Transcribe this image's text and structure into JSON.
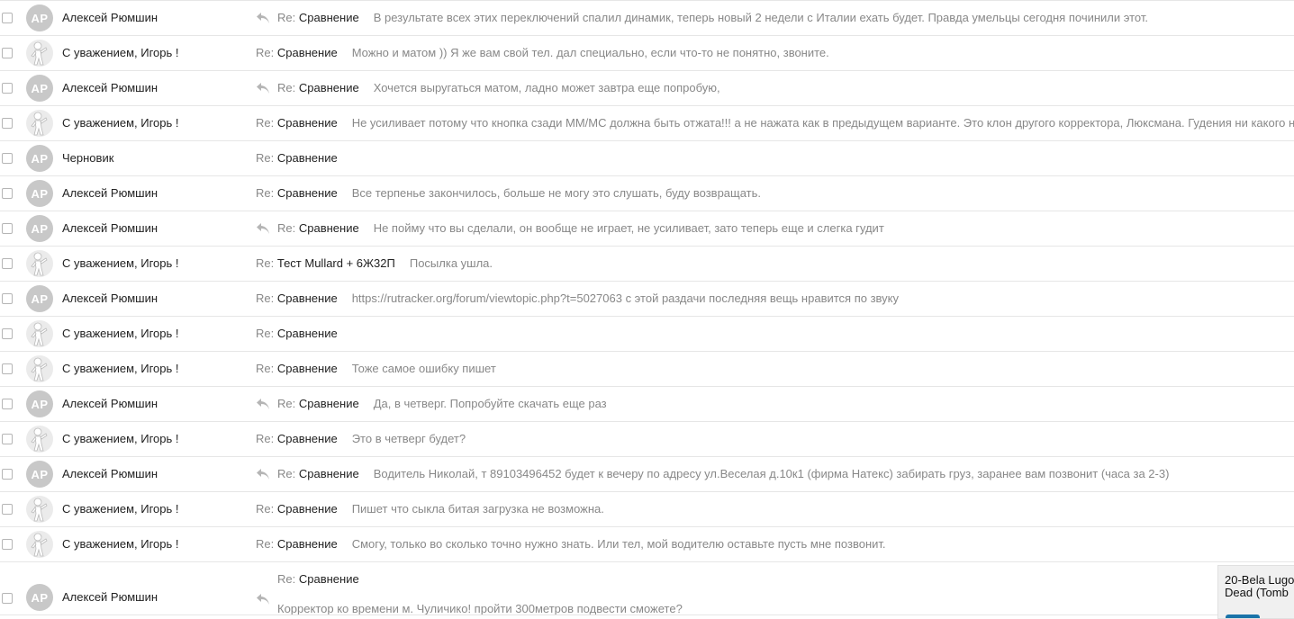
{
  "messages": [
    {
      "sender": "Алексей Рюмшин",
      "avatar": "AP",
      "avatar_type": "initials",
      "replied": true,
      "re": "Re:",
      "subject": "Сравнение",
      "snippet": "В результате всех этих переключений спалил динамик, теперь новый 2 недели с Италии ехать будет. Правда умельцы сегодня починили этот."
    },
    {
      "sender": "С уважением, Игорь !",
      "avatar": "",
      "avatar_type": "figure",
      "replied": false,
      "re": "Re:",
      "subject": "Сравнение",
      "snippet": "Можно и матом )) Я же вам свой тел. дал специально, если что-то не понятно, звоните."
    },
    {
      "sender": "Алексей Рюмшин",
      "avatar": "AP",
      "avatar_type": "initials",
      "replied": true,
      "re": "Re:",
      "subject": "Сравнение",
      "snippet": "Хочется выругаться матом, ладно может завтра еще попробую,"
    },
    {
      "sender": "С уважением, Игорь !",
      "avatar": "",
      "avatar_type": "figure",
      "replied": false,
      "re": "Re:",
      "subject": "Сравнение",
      "snippet": "Не усиливает потому что кнопка сзади ММ/МС должна быть отжата!!! а не нажата как в предыдущем варианте. Это клон другого корректора, Люксмана. Гудения ни какого н"
    },
    {
      "sender": "Черновик",
      "avatar": "AP",
      "avatar_type": "initials",
      "replied": false,
      "re": "Re:",
      "subject": "Сравнение",
      "snippet": ""
    },
    {
      "sender": "Алексей Рюмшин",
      "avatar": "AP",
      "avatar_type": "initials",
      "replied": false,
      "re": "Re:",
      "subject": "Сравнение",
      "snippet": "Все терпенье закончилось, больше не могу это слушать, буду возвращать."
    },
    {
      "sender": "Алексей Рюмшин",
      "avatar": "AP",
      "avatar_type": "initials",
      "replied": true,
      "re": "Re:",
      "subject": "Сравнение",
      "snippet": "Не пойму что вы сделали, он вообще не играет, не усиливает, зато теперь еще и слегка гудит"
    },
    {
      "sender": "С уважением, Игорь !",
      "avatar": "",
      "avatar_type": "figure",
      "replied": false,
      "re": "Re:",
      "subject": "Тест Mullard + 6Ж32П",
      "snippet": "Посылка ушла."
    },
    {
      "sender": "Алексей Рюмшин",
      "avatar": "AP",
      "avatar_type": "initials",
      "replied": false,
      "re": "Re:",
      "subject": "Сравнение",
      "snippet": "https://rutracker.org/forum/viewtopic.php?t=5027063 с этой раздачи последняя вещь нравится по звуку"
    },
    {
      "sender": "С уважением, Игорь !",
      "avatar": "",
      "avatar_type": "figure",
      "replied": false,
      "re": "Re:",
      "subject": "Сравнение",
      "snippet": ""
    },
    {
      "sender": "С уважением, Игорь !",
      "avatar": "",
      "avatar_type": "figure",
      "replied": false,
      "re": "Re:",
      "subject": "Сравнение",
      "snippet": "Тоже самое ошибку пишет"
    },
    {
      "sender": "Алексей Рюмшин",
      "avatar": "AP",
      "avatar_type": "initials",
      "replied": true,
      "re": "Re:",
      "subject": "Сравнение",
      "snippet": "Да, в четверг. Попробуйте скачать еще раз"
    },
    {
      "sender": "С уважением, Игорь !",
      "avatar": "",
      "avatar_type": "figure",
      "replied": false,
      "re": "Re:",
      "subject": "Сравнение",
      "snippet": "Это в четверг будет?"
    },
    {
      "sender": "Алексей Рюмшин",
      "avatar": "AP",
      "avatar_type": "initials",
      "replied": true,
      "re": "Re:",
      "subject": "Сравнение",
      "snippet": "Водитель Николай, т 89103496452 будет к вечеру по адресу ул.Веселая д.10к1 (фирма Натекс) забирать груз, заранее вам позвонит (часа за 2-3)"
    },
    {
      "sender": "С уважением, Игорь !",
      "avatar": "",
      "avatar_type": "figure",
      "replied": false,
      "re": "Re:",
      "subject": "Сравнение",
      "snippet": "Пишет что сыкла битая загрузка не возможна."
    },
    {
      "sender": "С уважением, Игорь !",
      "avatar": "",
      "avatar_type": "figure",
      "replied": false,
      "re": "Re:",
      "subject": "Сравнение",
      "snippet": "Смогу, только во сколько точно нужно знать. Или тел, мой водителю оставьте пусть мне позвонит."
    },
    {
      "sender": "Алексей Рюмшин",
      "avatar": "AP",
      "avatar_type": "initials",
      "replied": true,
      "re": "Re:",
      "subject": "Сравнение",
      "snippet": "Корректор ко времени м. Чуличико! пройти 300метров подвести сможете?",
      "tall": true
    }
  ],
  "popup": {
    "text_line1": "20-Bela Lugo",
    "text_line2": "Dead (Tomb"
  }
}
